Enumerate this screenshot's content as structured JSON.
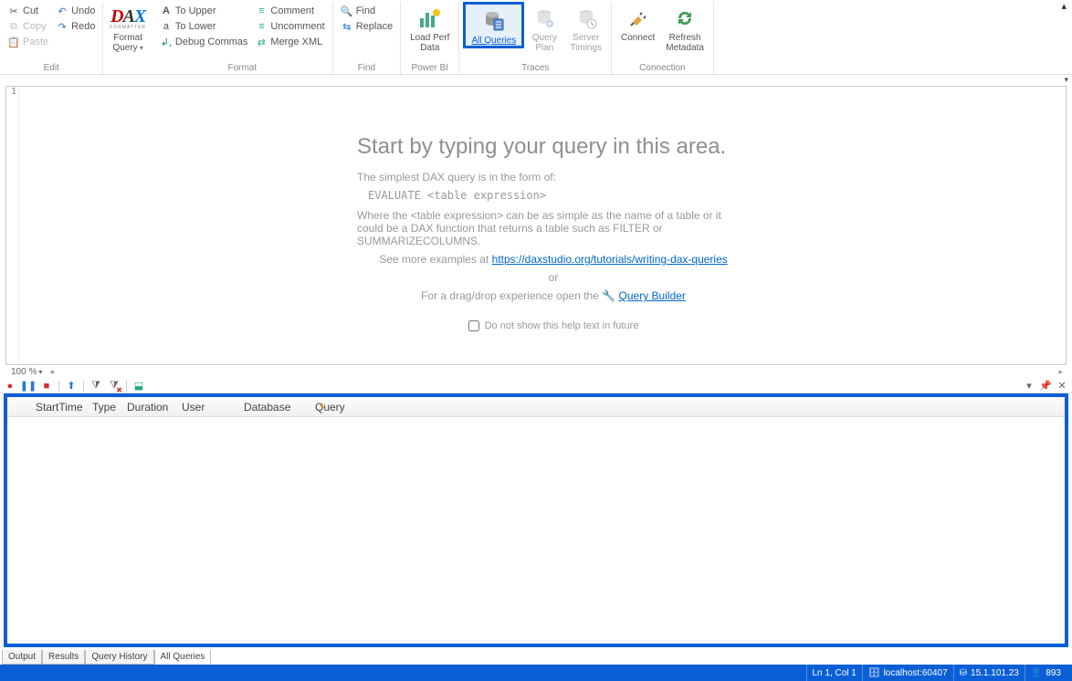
{
  "ribbon": {
    "edit": {
      "cut": "Cut",
      "copy": "Copy",
      "paste": "Paste",
      "undo": "Undo",
      "redo": "Redo",
      "group": "Edit"
    },
    "format_btn": {
      "top": "Format",
      "bottom": "Query"
    },
    "format": {
      "to_upper": "To Upper",
      "to_lower": "To Lower",
      "debug_commas": "Debug Commas",
      "comment": "Comment",
      "uncomment": "Uncomment",
      "merge_xml": "Merge XML",
      "group": "Format"
    },
    "find": {
      "find": "Find",
      "replace": "Replace",
      "group": "Find"
    },
    "powerbi": {
      "load_perf": "Load Perf\nData",
      "group": "Power BI"
    },
    "traces": {
      "all_queries": "All\nQueries",
      "query_plan": "Query\nPlan",
      "server_timings": "Server\nTimings",
      "group": "Traces"
    },
    "connection": {
      "connect": "Connect",
      "refresh": "Refresh\nMetadata",
      "group": "Connection"
    }
  },
  "editor": {
    "line_number": "1",
    "title": "Start by typing your query in this area.",
    "intro": "The simplest DAX query is in the form of:",
    "code": "EVALUATE <table expression>",
    "where1": "Where the <table expression> can be as simple as the name of a table or it could be a DAX function that returns a table such as FILTER or SUMMARIZECOLUMNS.",
    "examples_pre": "See more examples at ",
    "examples_link": "https://daxstudio.org/tutorials/writing-dax-queries",
    "or": "or",
    "drag_pre": "For a drag/drop experience open the ",
    "qb_link": "Query Builder",
    "checkbox": "Do not show this help text in future",
    "zoom": "100 %"
  },
  "results": {
    "columns": [
      "StartTime",
      "Type",
      "Duration",
      "User",
      "Database",
      "Query"
    ]
  },
  "tabs": {
    "output": "Output",
    "results": "Results",
    "history": "Query History",
    "all_queries": "All Queries"
  },
  "status": {
    "pos": "Ln 1, Col 1",
    "server": "localhost:60407",
    "version": "15.1.101.23",
    "spid": "893"
  }
}
